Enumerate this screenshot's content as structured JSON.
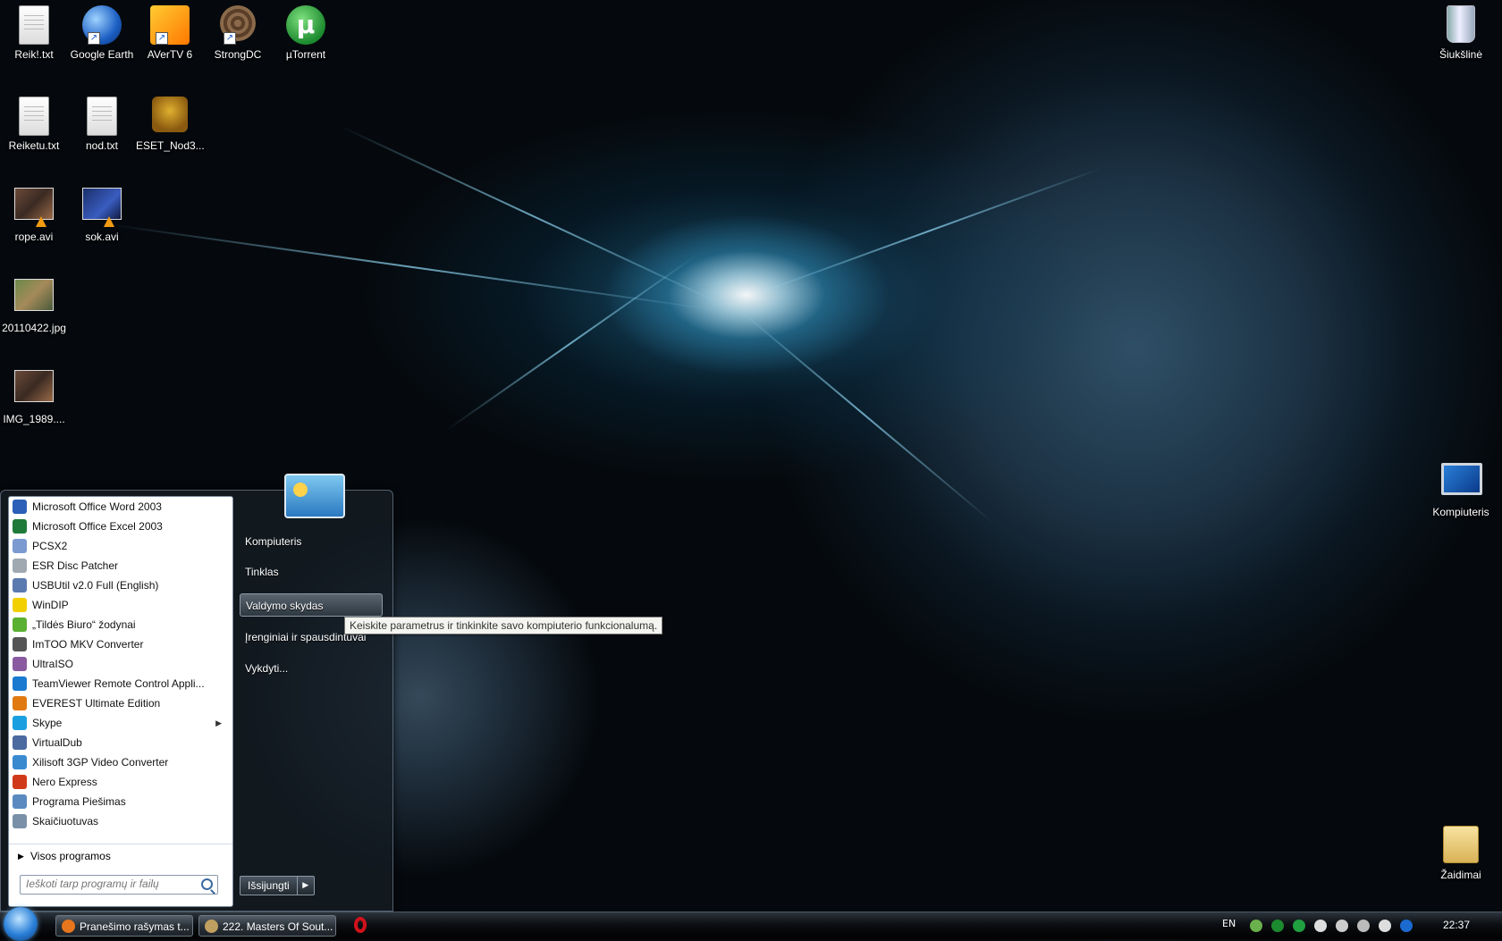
{
  "desktop": {
    "icons": [
      {
        "label": "Reik!.txt"
      },
      {
        "label": "Google Earth"
      },
      {
        "label": "AVerTV 6"
      },
      {
        "label": "StrongDC"
      },
      {
        "label": "µTorrent"
      },
      {
        "label": "Reiketu.txt"
      },
      {
        "label": "nod.txt"
      },
      {
        "label": "ESET_Nod3..."
      },
      {
        "label": "rope.avi"
      },
      {
        "label": "sok.avi"
      },
      {
        "label": "20110422.jpg"
      },
      {
        "label": "IMG_1989...."
      },
      {
        "label": "Šiukšlinė"
      },
      {
        "label": "Kompiuteris"
      },
      {
        "label": "Žaidimai"
      }
    ]
  },
  "start_menu": {
    "programs": [
      {
        "label": "Microsoft Office Word 2003",
        "color": "#2b5fb8"
      },
      {
        "label": "Microsoft Office Excel 2003",
        "color": "#1f7a3a"
      },
      {
        "label": "PCSX2",
        "color": "#7a9ad0"
      },
      {
        "label": "ESR Disc Patcher",
        "color": "#a0a8b0"
      },
      {
        "label": "USBUtil v2.0 Full (English)",
        "color": "#5a7ab0"
      },
      {
        "label": "WinDIP",
        "color": "#f2d000"
      },
      {
        "label": "„Tildės Biuro“ žodynai",
        "color": "#5ab030"
      },
      {
        "label": "ImTOO MKV Converter",
        "color": "#555555"
      },
      {
        "label": "UltraISO",
        "color": "#8a5aa0"
      },
      {
        "label": "TeamViewer Remote Control Appli...",
        "color": "#1a7ad0"
      },
      {
        "label": "EVEREST Ultimate Edition",
        "color": "#e07a10"
      },
      {
        "label": "Skype",
        "color": "#1aa0e0",
        "submenu": "▶"
      },
      {
        "label": "VirtualDub",
        "color": "#4a6aa0"
      },
      {
        "label": "Xilisoft 3GP Video Converter",
        "color": "#3a8ad0"
      },
      {
        "label": "Nero Express",
        "color": "#d03a1a"
      },
      {
        "label": "Programa Piešimas",
        "color": "#5a8ac0"
      },
      {
        "label": "Skaičiuotuvas",
        "color": "#7a90a8"
      }
    ],
    "all_programs": "Visos programos",
    "search_placeholder": "Ieškoti tarp programų ir failų",
    "right_items": [
      {
        "label": "Kompiuteris"
      },
      {
        "label": "Tinklas"
      },
      {
        "label": "Valdymo skydas"
      },
      {
        "label": "Įrenginiai ir spausdintuvai"
      },
      {
        "label": "Vykdyti..."
      }
    ],
    "shutdown": "Išsijungti",
    "shutdown_arrow": "▶",
    "tooltip": "Keiskite parametrus ir tinkinkite savo kompiuterio funkcionalumą."
  },
  "taskbar": {
    "buttons": [
      {
        "label": "Pranešimo rašymas t...",
        "color": "#e8761c"
      },
      {
        "label": "222. Masters Of Sout...",
        "color": "#c0a060"
      }
    ],
    "language": "EN",
    "tray_colors": [
      "#6ab04c",
      "#1c8a2e",
      "#20a040",
      "#dddddd",
      "#cccccc",
      "#bbbbbb",
      "#dddddd",
      "#1a6ad0"
    ],
    "clock": "22:37"
  }
}
